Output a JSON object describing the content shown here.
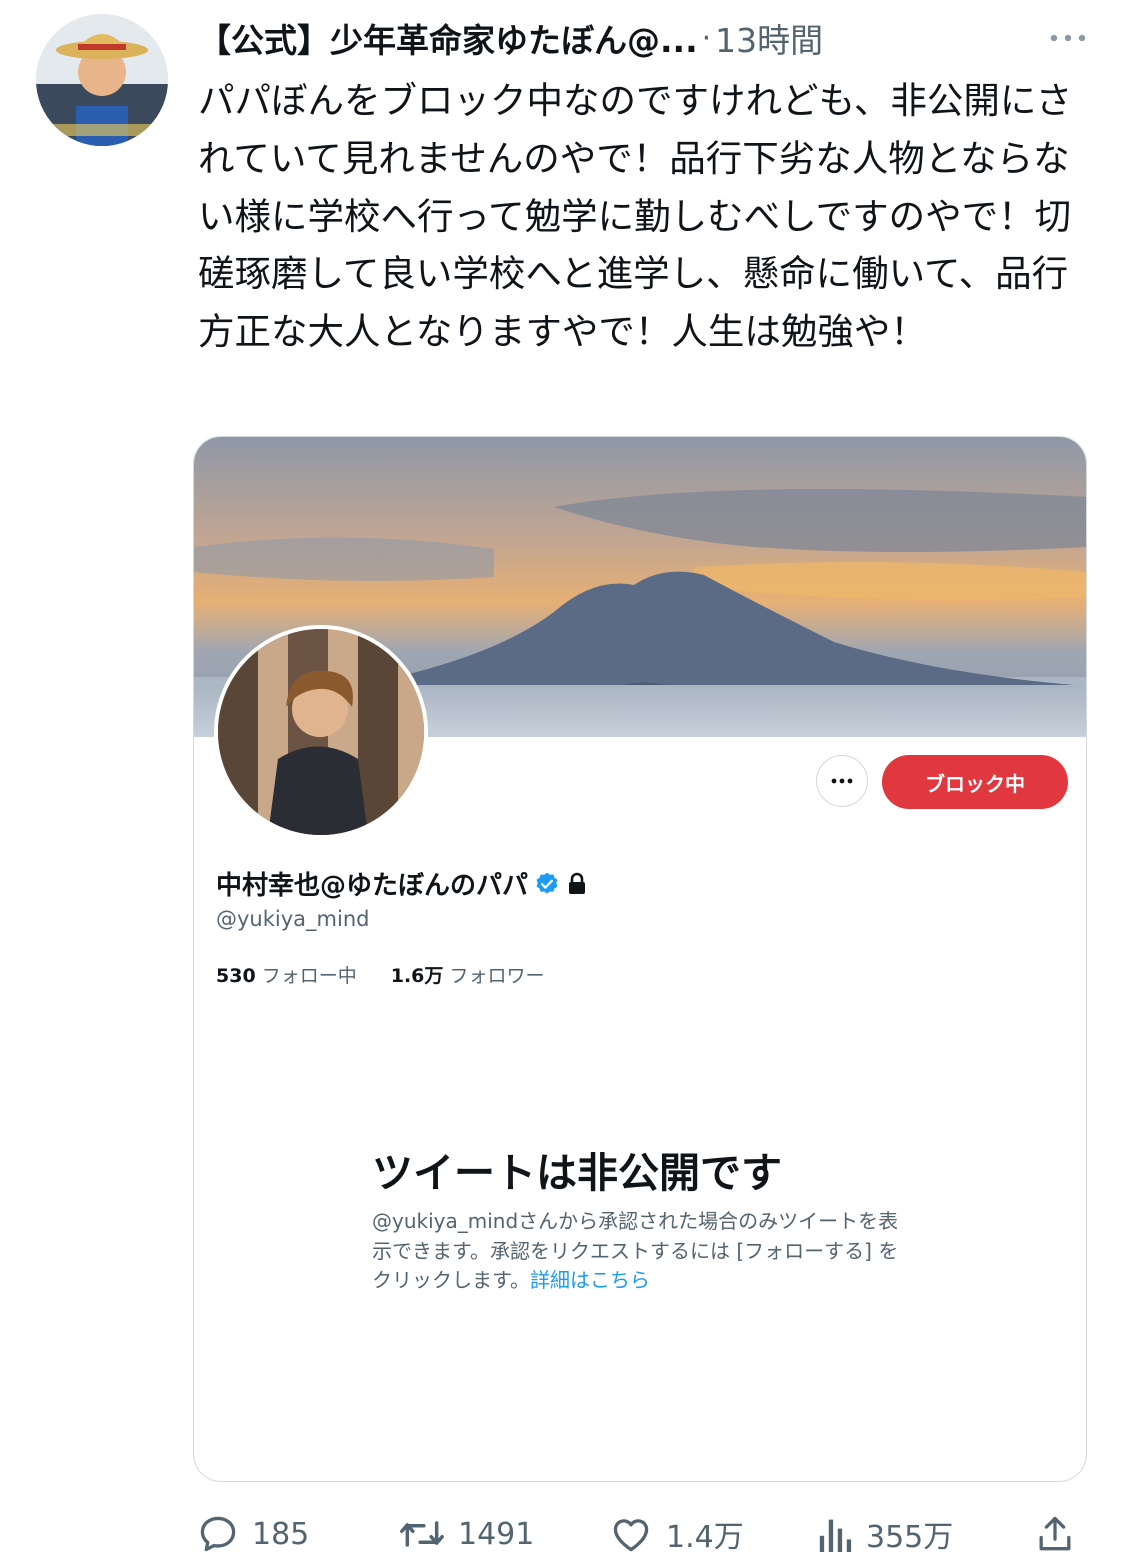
{
  "tweet": {
    "author_name": "【公式】少年革命家ゆたぼん@...",
    "separator": "·",
    "time": "13時間",
    "text": "パパぼんをブロック中なのですけれども、非公開にされていて見れませんのやで！品行下劣な人物とならない様に学校へ行って勉学に勤しむべしですのやで！切磋琢磨して良い学校へと進学し、懸命に働いて、品行方正な大人となりますやで！人生は勉強や！"
  },
  "card": {
    "block_label": "ブロック中",
    "profile_name": "中村幸也@ゆたぼんのパパ",
    "handle": "@yukiya_mind",
    "following_count": "530",
    "following_label": "フォロー中",
    "followers_count": "1.6万",
    "followers_label": "フォロワー",
    "private_title": "ツイートは非公開です",
    "private_desc": "@yukiya_mindさんから承認された場合のみツイートを表示できます。承認をリクエストするには [フォローする] をクリックします。",
    "learn_more": "詳細はこちら"
  },
  "actions": {
    "replies": "185",
    "retweets": "1491",
    "likes": "1.4万",
    "views": "355万"
  },
  "colors": {
    "accent": "#1d9bf0",
    "block_red": "#e0383e",
    "muted_text": "#536471"
  },
  "icons": [
    "more-icon",
    "verified-badge-icon",
    "lock-icon",
    "reply-icon",
    "retweet-icon",
    "like-icon",
    "views-icon",
    "share-icon"
  ]
}
